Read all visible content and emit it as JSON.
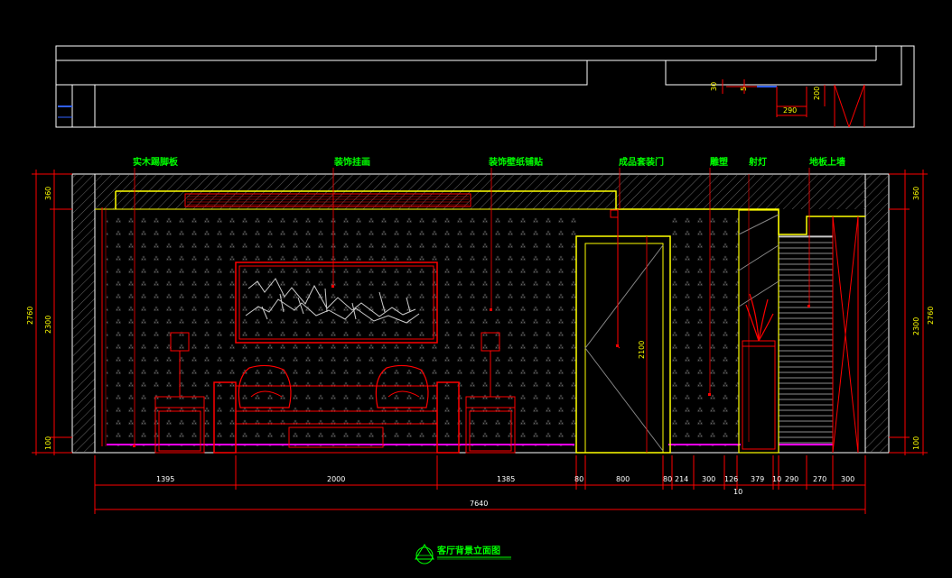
{
  "colors": {
    "background": "#000000",
    "outline": "#ffffff",
    "red": "#ff0000",
    "yellow": "#ffff00",
    "green": "#00ff00",
    "magenta": "#ff00ff",
    "hatch": "#888888"
  },
  "labels": {
    "label_1": "实木踢脚板",
    "label_2": "装饰挂画",
    "label_3": "装饰壁纸铺贴",
    "label_4": "成品套装门",
    "label_5": "雕塑",
    "label_6": "射灯",
    "label_7": "地板上墙"
  },
  "section": {
    "dim_30": "30",
    "dim_5": "5",
    "dim_200": "200",
    "dim_290": "290"
  },
  "vertical_dims": {
    "left_total": "2760",
    "left_upper": "360",
    "left_middle": "2300",
    "left_lower": "100",
    "right_total": "2760",
    "right_upper": "360",
    "right_middle": "2300",
    "right_lower": "100",
    "door_height": "2100"
  },
  "horizontal_dims": {
    "d1": "1395",
    "d2": "2000",
    "d3": "1385",
    "d4": "80",
    "d5": "800",
    "d6": "80",
    "d7": "214",
    "d8": "300",
    "d9": "126",
    "d10": "379",
    "d11": "10",
    "d12": "290",
    "d13": "270",
    "d14": "300",
    "d_under": "10",
    "total": "7640"
  },
  "title": {
    "text": "客厅背景立面图",
    "symbol_icon": "elevation-marker-icon"
  }
}
